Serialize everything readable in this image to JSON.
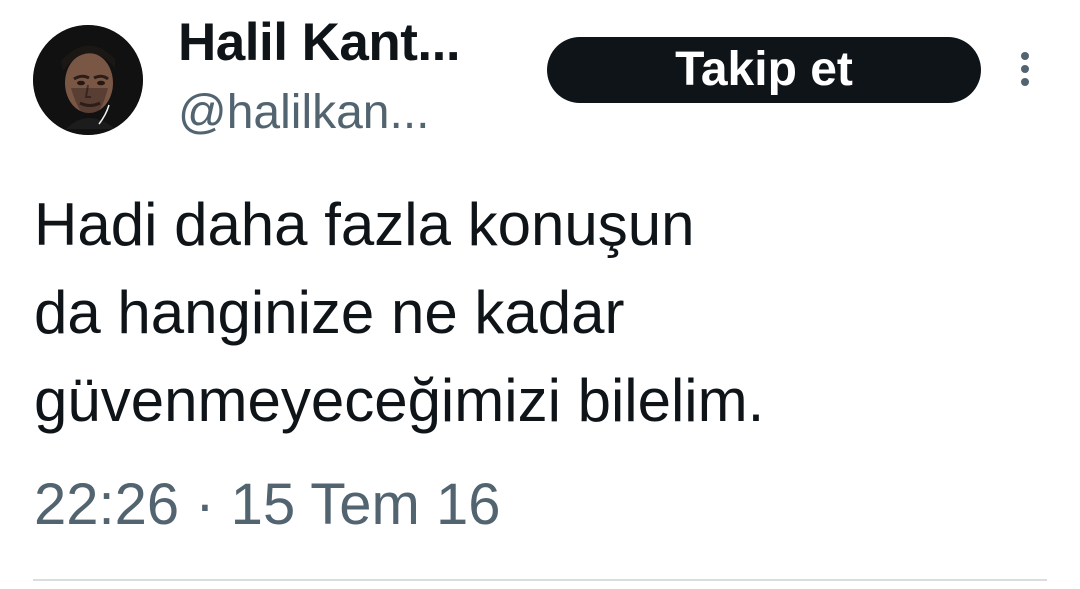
{
  "author": {
    "name": "Halil Kant...",
    "handle": "@halilkan...",
    "avatar_icon": "user-avatar"
  },
  "actions": {
    "follow_label": "Takip et",
    "more_icon": "more-vertical-icon"
  },
  "tweet": {
    "lines": [
      "Hadi daha fazla konuşun",
      "da hanginize ne kadar",
      "güvenmeyeceğimizi bilelim."
    ],
    "timestamp": "22:26 · 15 Tem 16"
  },
  "colors": {
    "text_primary": "#0f1419",
    "text_secondary": "#536471",
    "button_background": "#0f1419",
    "button_text": "#ffffff",
    "divider": "#d9dde1",
    "background": "#ffffff"
  }
}
